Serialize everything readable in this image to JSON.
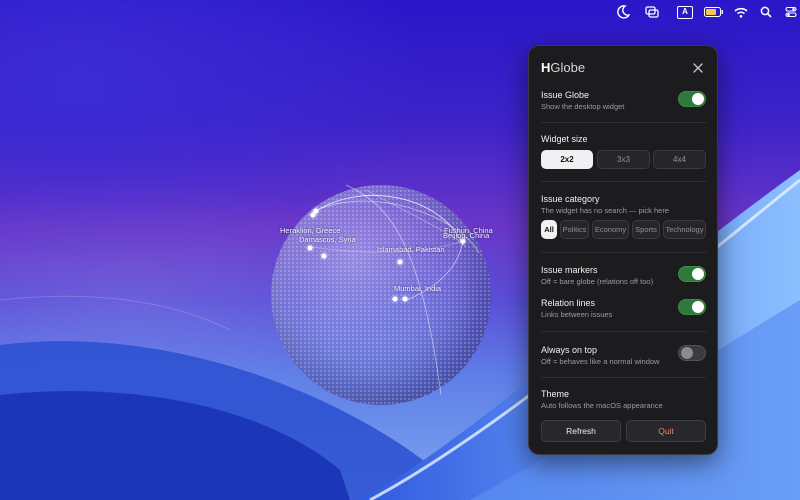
{
  "menubar": {
    "icons": [
      "moon-icon",
      "window-stack-icon",
      "input-source-icon",
      "battery-icon",
      "wifi-icon",
      "search-icon",
      "control-center-icon"
    ],
    "input_source_label": "A"
  },
  "globe": {
    "cities": [
      {
        "name": "Heraklion, Greece"
      },
      {
        "name": "Damascus, Syria"
      },
      {
        "name": "Islamabad, Pakistan"
      },
      {
        "name": "Mumbai, India"
      },
      {
        "name": "Fushun, China"
      },
      {
        "name": "Beijing, China"
      }
    ]
  },
  "panel": {
    "title_bold": "H",
    "title_rest": "Globe",
    "issue_globe": {
      "label": "Issue Globe",
      "sub": "Show the desktop widget",
      "on": true
    },
    "widget_size": {
      "label": "Widget size",
      "options": [
        "2x2",
        "3x3",
        "4x4"
      ],
      "selected": "2x2"
    },
    "issue_category": {
      "label": "Issue category",
      "sub": "The widget has no search — pick here",
      "options": [
        "All",
        "Politics",
        "Economy",
        "Sports",
        "Technology"
      ],
      "selected": "All"
    },
    "issue_markers": {
      "label": "Issue markers",
      "sub": "Off = bare globe (relations off too)",
      "on": true
    },
    "relation_lines": {
      "label": "Relation lines",
      "sub": "Links between issues",
      "on": true
    },
    "always_on_top": {
      "label": "Always on top",
      "sub": "Off = behaves like a normal window",
      "on": false
    },
    "theme": {
      "label": "Theme",
      "sub": "Auto follows the macOS appearance"
    },
    "refresh_label": "Refresh",
    "quit_label": "Quit"
  },
  "colors": {
    "toggle_on": "#2f7a3a",
    "quit_text": "#e8806a",
    "panel_bg": "#1c1c1f"
  }
}
